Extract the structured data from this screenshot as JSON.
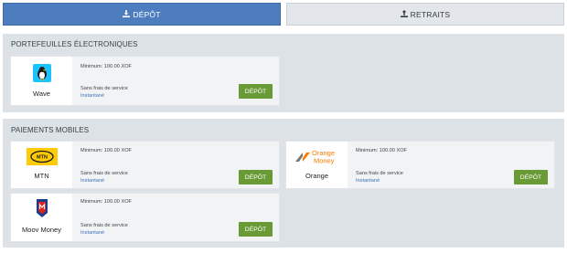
{
  "tabs": {
    "deposit": "DÉPÔT",
    "withdraw": "RETRAITS"
  },
  "sections": {
    "wallets": {
      "title": "PORTEFEUILLES ÉLECTRONIQUES",
      "cards": [
        {
          "name": "Wave",
          "minimum": "Minimum: 100.00 XOF",
          "fees": "Sans frais de service",
          "speed": "Instantané",
          "button": "DÉPÔT"
        }
      ]
    },
    "mobile": {
      "title": "PAIEMENTS MOBILES",
      "cards": [
        {
          "name": "MTN",
          "minimum": "Minimum: 100.00 XOF",
          "fees": "Sans frais de service",
          "speed": "Instantané",
          "button": "DÉPÔT"
        },
        {
          "name": "Orange",
          "minimum": "Minimum: 100.00 XOF",
          "fees": "Sans frais de service",
          "speed": "Instantané",
          "button": "DÉPÔT"
        },
        {
          "name": "Moov Money",
          "minimum": "Minimum: 100.00 XOF",
          "fees": "Sans frais de service",
          "speed": "Instantané",
          "button": "DÉPÔT"
        }
      ]
    }
  },
  "logos": {
    "mtn_text": "MTN",
    "orange_line1": "Orange",
    "orange_line2": "Money"
  },
  "colors": {
    "accent": "#4e7dbf",
    "button": "#6a9a36",
    "section_bg": "#dde2e7",
    "link": "#3e74b8",
    "mtn_yellow": "#ffcb05",
    "orange": "#ff7900",
    "wave_blue": "#1dc3ff"
  }
}
